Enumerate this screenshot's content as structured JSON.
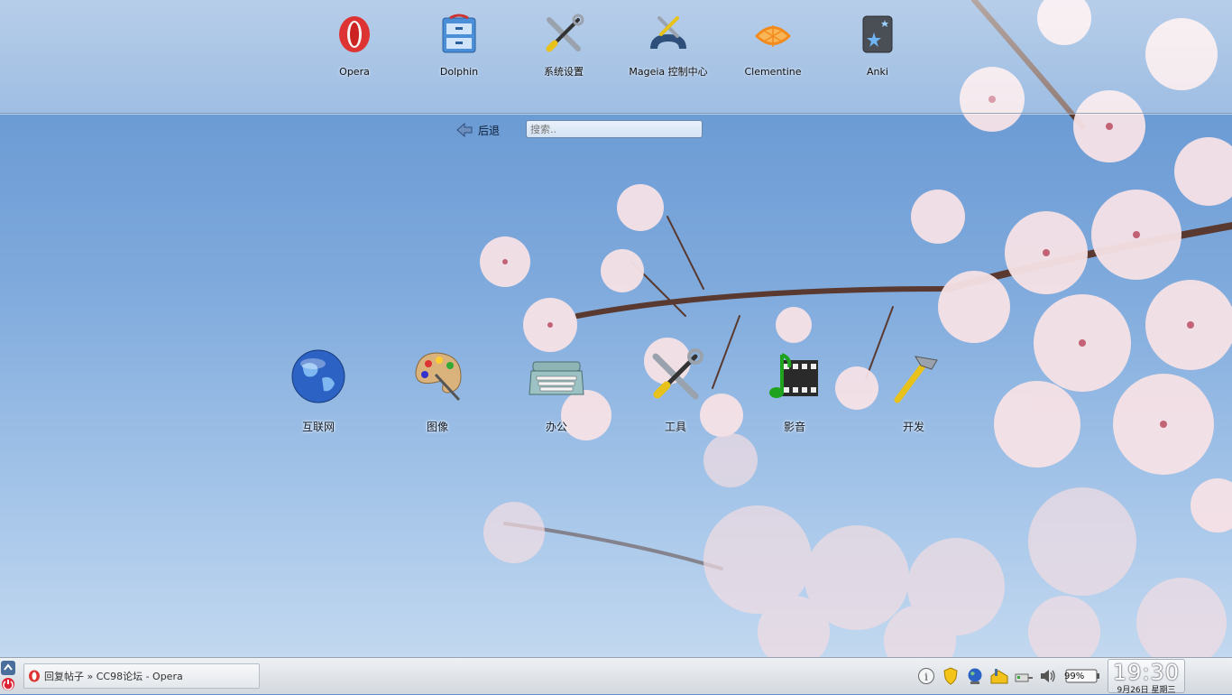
{
  "favorites": [
    {
      "label": "Opera",
      "icon": "opera-icon"
    },
    {
      "label": "Dolphin",
      "icon": "dolphin-icon"
    },
    {
      "label": "系统设置",
      "icon": "system-settings-icon"
    },
    {
      "label": "Mageia 控制中心",
      "icon": "mageia-control-center-icon"
    },
    {
      "label": "Clementine",
      "icon": "clementine-icon"
    },
    {
      "label": "Anki",
      "icon": "anki-icon"
    }
  ],
  "nav": {
    "back_label": "后退",
    "search_placeholder": "搜索.."
  },
  "categories": [
    {
      "label": "互联网",
      "icon": "globe-icon"
    },
    {
      "label": "图像",
      "icon": "palette-icon"
    },
    {
      "label": "办公",
      "icon": "typewriter-icon"
    },
    {
      "label": "工具",
      "icon": "tools-icon"
    },
    {
      "label": "影音",
      "icon": "multimedia-icon"
    },
    {
      "label": "开发",
      "icon": "hammer-icon"
    }
  ],
  "taskbar": {
    "window_title": "回复帖子 » CC98论坛 - Opera",
    "battery": "99%",
    "time": "19:30",
    "date": "9月26日 星期三"
  }
}
